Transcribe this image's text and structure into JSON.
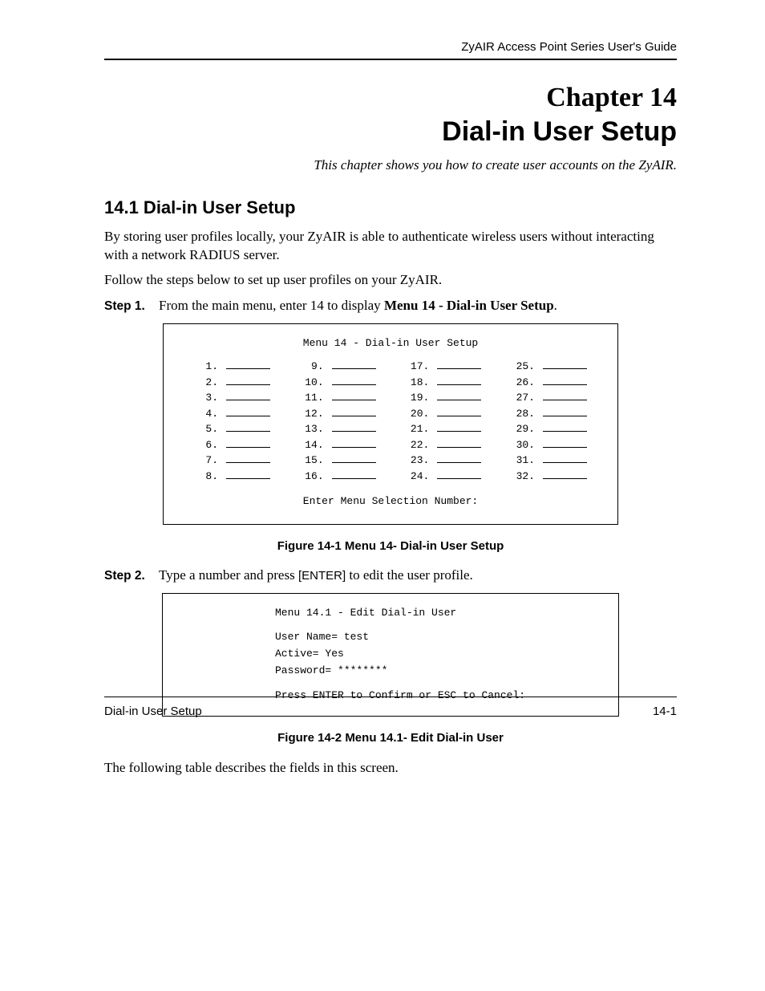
{
  "header": {
    "running": "ZyAIR Access Point Series User's Guide"
  },
  "chapter": {
    "number_line": "Chapter 14",
    "title": "Dial-in User Setup",
    "intro": "This chapter shows you how to create user accounts on the ZyAIR."
  },
  "section": {
    "heading": "14.1  Dial-in User Setup",
    "para1": "By storing user profiles locally, your ZyAIR is able to authenticate wireless users without interacting with a network RADIUS server.",
    "para2": "Follow the steps below to set up user profiles on your ZyAIR."
  },
  "steps": {
    "s1": {
      "label": "Step 1.",
      "text_pre": "From the main menu, enter 14 to display ",
      "menu": "Menu 14 - Dial-in User Setup",
      "text_post": "."
    },
    "s2": {
      "label": "Step 2.",
      "text_pre": "Type a number and press ",
      "key": "[ENTER]",
      "text_post": " to edit the user profile."
    }
  },
  "screen1": {
    "title": "Menu 14 - Dial-in User Setup",
    "columns": [
      [
        "1.",
        "2.",
        "3.",
        "4.",
        "5.",
        "6.",
        "7.",
        "8."
      ],
      [
        "9.",
        "10.",
        "11.",
        "12.",
        "13.",
        "14.",
        "15.",
        "16."
      ],
      [
        "17.",
        "18.",
        "19.",
        "20.",
        "21.",
        "22.",
        "23.",
        "24."
      ],
      [
        "25.",
        "26.",
        "27.",
        "28.",
        "29.",
        "30.",
        "31.",
        "32."
      ]
    ],
    "prompt": "Enter Menu Selection Number:"
  },
  "figure1": "Figure 14-1 Menu 14- Dial-in User Setup",
  "screen2": {
    "title": "Menu 14.1 - Edit Dial-in User",
    "line1": "User Name= test",
    "line2": "Active= Yes",
    "line3": "Password= ********",
    "line4": "Press ENTER to Confirm or ESC to Cancel:"
  },
  "figure2": "Figure 14-2 Menu 14.1- Edit Dial-in User",
  "closing": "The following table describes the fields in this screen.",
  "footer": {
    "left": "Dial-in User Setup",
    "right": "14-1"
  }
}
